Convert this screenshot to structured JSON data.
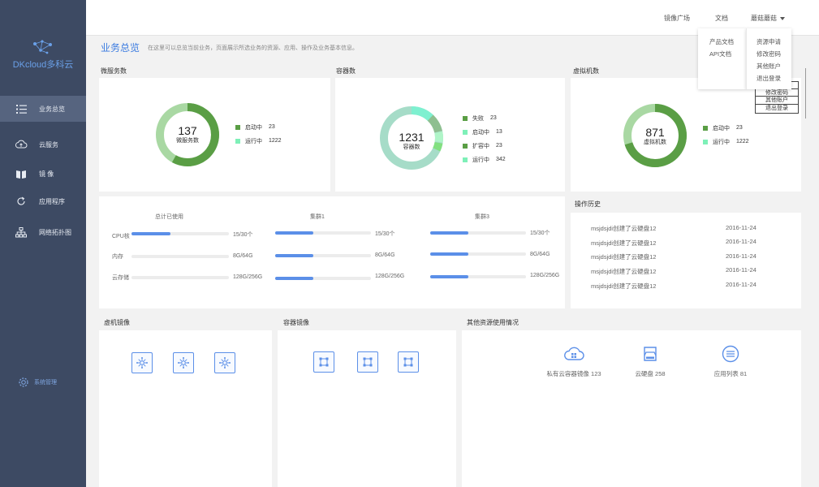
{
  "brand": {
    "logo_text": "DKcloud多科云"
  },
  "sidebar": {
    "items": [
      {
        "label": "业务总览",
        "icon": "list-icon"
      },
      {
        "label": "云服务",
        "icon": "cloud-icon"
      },
      {
        "label": "镜 像",
        "icon": "book-icon"
      },
      {
        "label": "应用程序",
        "icon": "refresh-icon"
      },
      {
        "label": "网络拓扑图",
        "icon": "network-icon"
      }
    ],
    "settings_label": "系统管理"
  },
  "topbar": {
    "mirror_square": "镜像广场",
    "docs": "文档",
    "user": "蘑菇蘑菇"
  },
  "docs_menu": [
    "产品文档",
    "API文档"
  ],
  "user_menu": [
    "资源申请",
    "修改密码",
    "其他账户",
    "退出登录"
  ],
  "user_menu_ghost": [
    "修改密码",
    "其他账户",
    "退出登录"
  ],
  "page": {
    "title": "业务总览",
    "desc": "在这里可以总览当前业务，页面展示所选业务的资源、应用、操作及业务基本信息。"
  },
  "microservices": {
    "title": "微服务数",
    "total": "137",
    "label": "微服务数",
    "legend": [
      {
        "name": "启动中",
        "value": "23",
        "color": "#5a9e45"
      },
      {
        "name": "运行中",
        "value": "1222",
        "color": "#7ef0b8"
      }
    ]
  },
  "containers": {
    "title": "容器数",
    "total": "1231",
    "label": "容器数",
    "legend": [
      {
        "name": "失败",
        "value": "23",
        "color": "#5a9e45"
      },
      {
        "name": "启动中",
        "value": "13",
        "color": "#7ef0b8"
      },
      {
        "name": "扩容中",
        "value": "23",
        "color": "#5a9e45"
      },
      {
        "name": "运行中",
        "value": "342",
        "color": "#7ef0b8"
      }
    ]
  },
  "vms": {
    "title": "虚拟机数",
    "total": "871",
    "label": "虚拟机数",
    "legend": [
      {
        "name": "启动中",
        "value": "23",
        "color": "#5a9e45"
      },
      {
        "name": "运行中",
        "value": "1222",
        "color": "#7ef0b8"
      }
    ]
  },
  "usage": {
    "groups": [
      "总计已使用",
      "集群1",
      "集群3"
    ],
    "rows": [
      "CPU核",
      "内存",
      "云存储"
    ],
    "values": [
      [
        {
          "text": "15/30个",
          "fill": 0.4
        },
        {
          "text": "15/30个",
          "fill": 0.4
        },
        {
          "text": "15/30个",
          "fill": 0.4
        }
      ],
      [
        {
          "text": "8G/64G",
          "fill": 0
        },
        {
          "text": "8G/64G",
          "fill": 0.4
        },
        {
          "text": "8G/64G",
          "fill": 0.4
        }
      ],
      [
        {
          "text": "128G/256G",
          "fill": 0
        },
        {
          "text": "128G/256G",
          "fill": 0.4
        },
        {
          "text": "128G/256G",
          "fill": 0.4
        }
      ]
    ]
  },
  "history": {
    "title": "操作历史",
    "rows": [
      {
        "text": "msjdsjdi创建了云硬盘12",
        "date": "2016-11-24"
      },
      {
        "text": "msjdsjdi创建了云硬盘12",
        "date": "2016-11-24"
      },
      {
        "text": "msjdsjdi创建了云硬盘12",
        "date": "2016-11-24"
      },
      {
        "text": "msjdsjdi创建了云硬盘12",
        "date": "2016-11-24"
      },
      {
        "text": "msjdsjdi创建了云硬盘12",
        "date": "2016-11-24"
      }
    ]
  },
  "vm_images": {
    "title": "虚机镜像"
  },
  "container_images": {
    "title": "容器镜像"
  },
  "other_resources": {
    "title": "其他资源使用情况",
    "items": [
      {
        "label": "私有云容器镜像",
        "value": "123",
        "icon": "cloud-box-icon"
      },
      {
        "label": "云硬盘",
        "value": "258",
        "icon": "disk-icon"
      },
      {
        "label": "应用列表",
        "value": "81",
        "icon": "list-circle-icon"
      }
    ]
  },
  "colors": {
    "accent": "#3b7be0",
    "sidebar": "#3d4a63",
    "green": "#5a9e45",
    "mint": "#7ef0b8",
    "bar": "#5b8fe8"
  }
}
